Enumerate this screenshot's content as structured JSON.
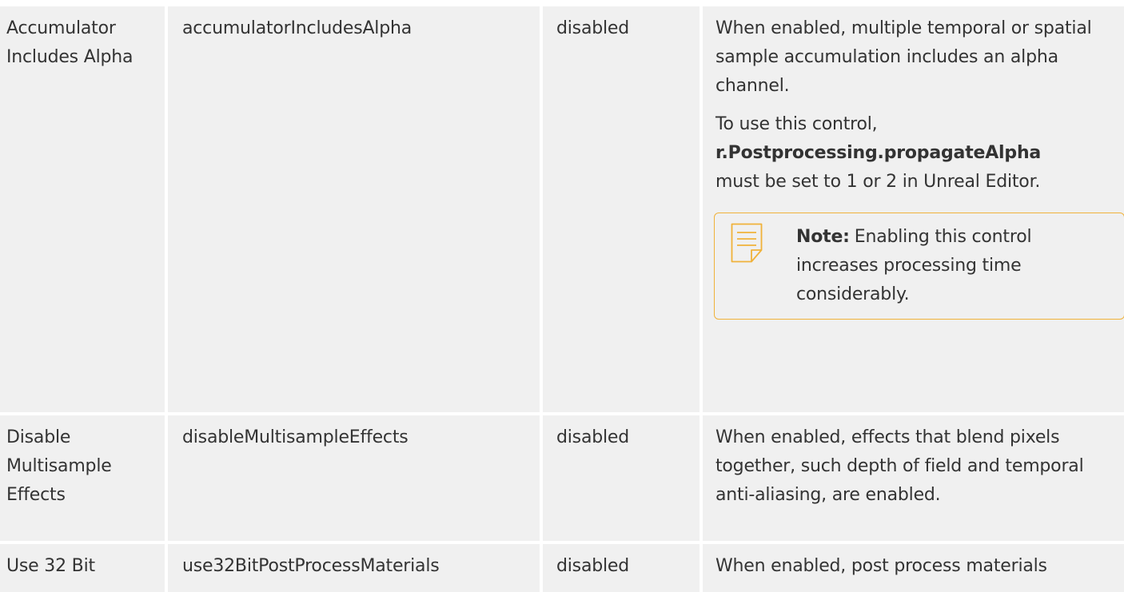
{
  "rows": [
    {
      "name": "Accumulator Includes Alpha",
      "key": "accumulatorIncludesAlpha",
      "default": "disabled",
      "description": "When enabled, multiple temporal or spatial sample accumulation includes an alpha channel.",
      "usage_prefix": "To use this control,",
      "usage_code": "r.Postprocessing.propagateAlpha",
      "usage_suffix": "must be set to 1 or 2 in Unreal Editor.",
      "note_label": "Note:",
      "note_text": "Enabling this control increases processing time considerably."
    },
    {
      "name": "Disable Multisample Effects",
      "key": "disableMultisampleEffects",
      "default": "disabled",
      "description": "When enabled, effects that blend pixels together, such depth of field and temporal anti-aliasing, are enabled."
    },
    {
      "name": "Use 32 Bit",
      "key": "use32BitPostProcessMaterials",
      "default": "disabled",
      "description": "When enabled, post process materials"
    }
  ],
  "icons": {
    "note": "note-icon"
  },
  "colors": {
    "cell_bg": "#f0f0f0",
    "note_border": "#f0b23a",
    "text": "#333333"
  }
}
